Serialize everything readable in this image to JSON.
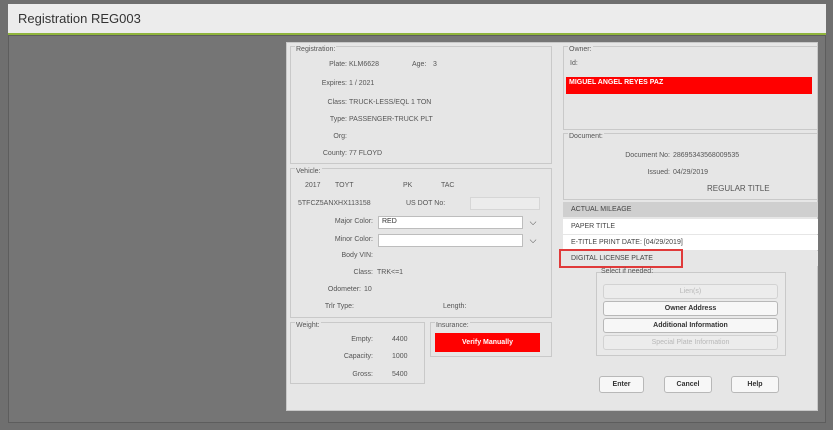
{
  "window": {
    "title": "Registration REG003"
  },
  "registration": {
    "legend": "Registration:",
    "plate_label": "Plate:",
    "plate_value": "KLM6628",
    "age_label": "Age:",
    "age_value": "3",
    "expires_label": "Expires:",
    "expires_value": "1   / 2021",
    "class_label": "Class:",
    "class_value": "TRUCK-LESS/EQL 1 TON",
    "type_label": "Type:",
    "type_value": "PASSENGER-TRUCK PLT",
    "org_label": "Org:",
    "county_label": "County:",
    "county_value": "77 FLOYD"
  },
  "vehicle": {
    "legend": "Vehicle:",
    "year": "2017",
    "make": "TOYT",
    "body": "PK",
    "model": "TAC",
    "vin": "5TFCZ5ANXHX113158",
    "usdot_label": "US DOT No:",
    "usdot_value": "",
    "major_color_label": "Major Color:",
    "major_color_value": "RED",
    "minor_color_label": "Minor Color:",
    "minor_color_value": "",
    "body_vin_label": "Body VIN:",
    "class_label": "Class:",
    "class_value": "TRK<=1",
    "odometer_label": "Odometer:",
    "odometer_value": "10",
    "trlr_type_label": "Trlr Type:",
    "length_label": "Length:"
  },
  "weight": {
    "legend": "Weight:",
    "empty_label": "Empty:",
    "empty_value": "4400",
    "capacity_label": "Capacity:",
    "capacity_value": "1000",
    "gross_label": "Gross:",
    "gross_value": "5400"
  },
  "insurance": {
    "legend": "Insurance:",
    "status": "Verify Manually"
  },
  "owner": {
    "legend": "Owner:",
    "id_label": "Id:",
    "name": "MIGUEL ANGEL REYES PAZ"
  },
  "document": {
    "legend": "Document:",
    "doc_no_label": "Document No:",
    "doc_no_value": "28695343568009535",
    "issued_label": "Issued:",
    "issued_value": "04/29/2019",
    "title_type": "REGULAR TITLE"
  },
  "notes": [
    "ACTUAL MILEAGE",
    "PAPER TITLE",
    "E-TITLE PRINT DATE: [04/29/2019]",
    "DIGITAL LICENSE PLATE"
  ],
  "actions": {
    "hint": "Select if needed:",
    "liens": "Lien(s)",
    "owner_address": "Owner Address",
    "additional_information": "Additional Information",
    "special_plate_information": "Special Plate Information"
  },
  "footer": {
    "enter": "Enter",
    "cancel": "Cancel",
    "help": "Help"
  },
  "colors": {
    "alert_red": "#ff0000",
    "highlight_border": "#e03a3a",
    "title_underline": "#8fb43c"
  }
}
